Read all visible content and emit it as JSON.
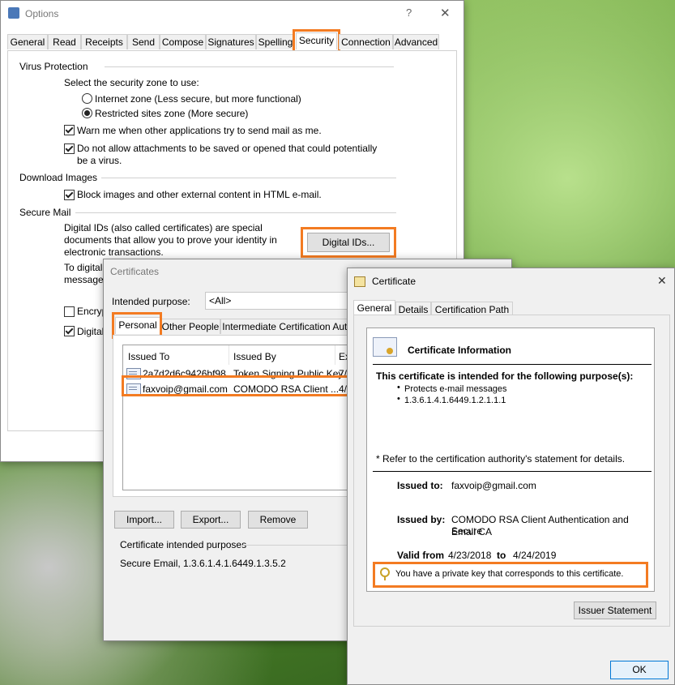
{
  "options": {
    "title": "Options",
    "help_glyph": "?",
    "close_glyph": "✕",
    "tabs": [
      "General",
      "Read",
      "Receipts",
      "Send",
      "Compose",
      "Signatures",
      "Spelling",
      "Security",
      "Connection",
      "Advanced"
    ],
    "virus_heading": "Virus Protection",
    "zone_prompt": "Select the security zone to use:",
    "zone_internet": "Internet zone (Less secure, but more functional)",
    "zone_restricted": "Restricted sites zone (More secure)",
    "warn_label": "Warn me when other applications try to send mail as me.",
    "attach_label_1": "Do not allow attachments to be saved or opened that could potentially",
    "attach_label_2": "be a virus.",
    "download_heading": "Download Images",
    "block_label": "Block images and other external content in HTML e-mail.",
    "secure_heading": "Secure Mail",
    "digital_desc_1": "Digital IDs (also called certificates) are special",
    "digital_desc_2": "documents that allow you to prove your identity in",
    "digital_desc_3": "electronic transactions.",
    "digital_ids_button": "Digital IDs...",
    "to_digital_partial": "To digital",
    "messages_partial": "messages",
    "encrypt_partial": "Encryp",
    "digital_partial": "Digital"
  },
  "certificates": {
    "title": "Certificates",
    "purpose_label": "Intended purpose:",
    "purpose_value": "<All>",
    "tabs": [
      "Personal",
      "Other People",
      "Intermediate Certification Autho"
    ],
    "columns": [
      "Issued To",
      "Issued By",
      "Ex"
    ],
    "rows": [
      {
        "issued_to": "2a7d2d6c9426bf98",
        "issued_by": "Token Signing Public Key",
        "exp": "7/"
      },
      {
        "issued_to": "faxvoip@gmail.com",
        "issued_by": "COMODO RSA Client ...",
        "exp": "4/"
      }
    ],
    "import_button": "Import...",
    "export_button": "Export...",
    "remove_button": "Remove",
    "purposes_heading": "Certificate intended purposes",
    "purposes_value": "Secure Email, 1.3.6.1.4.1.6449.1.3.5.2"
  },
  "certificate": {
    "title": "Certificate",
    "close_glyph": "✕",
    "tabs": [
      "General",
      "Details",
      "Certification Path"
    ],
    "info_heading": "Certificate Information",
    "intended_line": "This certificate is intended for the following purpose(s):",
    "purpose_items": [
      "Protects e-mail messages",
      "1.3.6.1.4.1.6449.1.2.1.1.1"
    ],
    "refer_note": "* Refer to the certification authority's statement for details.",
    "issued_to_label": "Issued to:",
    "issued_to_value": "faxvoip@gmail.com",
    "issued_by_label": "Issued by:",
    "issued_by_value_1": "COMODO RSA Client Authentication and Secure",
    "issued_by_value_2": "Email CA",
    "valid_from_label": "Valid from",
    "valid_from_value": "4/23/2018",
    "valid_to_label": "to",
    "valid_to_value": "4/24/2019",
    "private_key_note": "You have a private key that corresponds to this certificate.",
    "issuer_statement_button": "Issuer Statement",
    "ok_button": "OK"
  },
  "colors": {
    "highlight": "#f37b22"
  }
}
